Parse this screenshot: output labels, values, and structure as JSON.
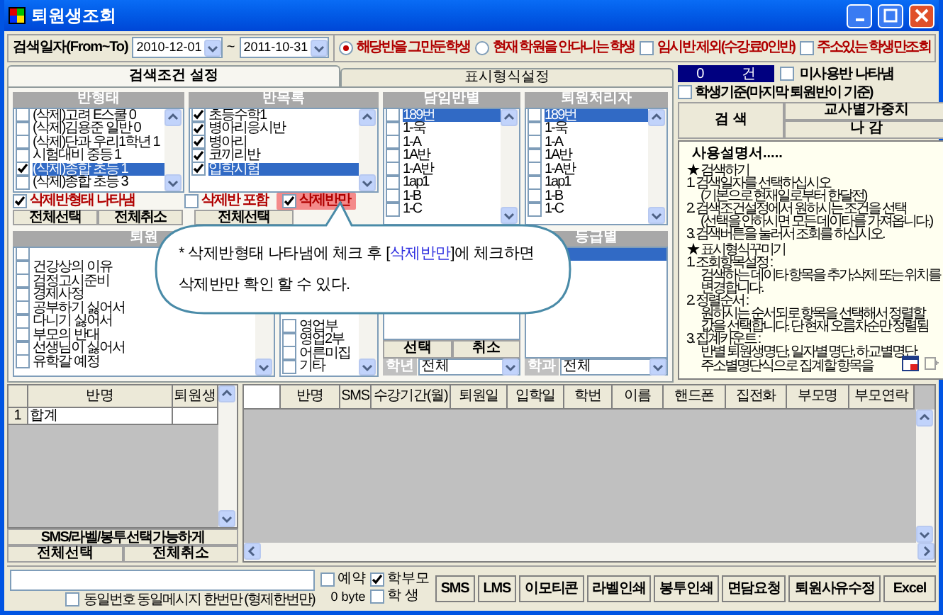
{
  "window": {
    "title": "퇴원생조회"
  },
  "search_bar": {
    "label": "검색일자(From~To)",
    "date_from": "2010-12-01",
    "separator": "~",
    "date_to": "2011-10-31",
    "options": [
      {
        "kind": "radio",
        "label": "해당반을 그만둔학생",
        "selected": true
      },
      {
        "kind": "radio",
        "label": "현재 학원을 안다니는 학생",
        "selected": false
      },
      {
        "kind": "checkbox",
        "label": "임시반 제외(수강료0인반)",
        "checked": false
      },
      {
        "kind": "checkbox",
        "label": "주소있는 학생만조회",
        "checked": false
      }
    ]
  },
  "tabs": [
    {
      "label": "검색조건 설정",
      "selected": true
    },
    {
      "label": "표시형식설정",
      "selected": false
    }
  ],
  "lists": [
    {
      "title": "반형태",
      "items": [
        {
          "label": "(삭제)고려 E스쿨 0",
          "checked": false,
          "selected": false
        },
        {
          "label": "(삭제)김용준 일반 0",
          "checked": false,
          "selected": false
        },
        {
          "label": "(삭제)단과 우리1학년 1",
          "checked": false,
          "selected": false
        },
        {
          "label": "시험대비 중등 1",
          "checked": false,
          "selected": false
        },
        {
          "label": "(삭제)종합 초등 1",
          "checked": true,
          "selected": true
        },
        {
          "label": "(삭제)종합 초등 3",
          "checked": false,
          "selected": false
        }
      ]
    },
    {
      "title": "반목록",
      "items": [
        {
          "label": "초등수학1",
          "checked": true,
          "selected": false
        },
        {
          "label": "병아리응시반",
          "checked": true,
          "selected": false
        },
        {
          "label": "병아리",
          "checked": true,
          "selected": false
        },
        {
          "label": "코끼리반",
          "checked": true,
          "selected": false
        },
        {
          "label": "입학시험",
          "checked": true,
          "selected": true
        }
      ]
    },
    {
      "title": "담임반별",
      "items": [
        {
          "label": "189번",
          "checked": false,
          "selected": true
        },
        {
          "label": "1-욱",
          "checked": false,
          "selected": false
        },
        {
          "label": "1-A",
          "checked": false,
          "selected": false
        },
        {
          "label": "1A반",
          "checked": false,
          "selected": false
        },
        {
          "label": "1-A반",
          "checked": false,
          "selected": false
        },
        {
          "label": "1ap1",
          "checked": false,
          "selected": false
        },
        {
          "label": "1-B",
          "checked": false,
          "selected": false
        },
        {
          "label": "1-C",
          "checked": false,
          "selected": false
        }
      ]
    },
    {
      "title": "퇴원처리자",
      "items": [
        {
          "label": "189번",
          "checked": false,
          "selected": true
        },
        {
          "label": "1-욱",
          "checked": false,
          "selected": false
        },
        {
          "label": "1-A",
          "checked": false,
          "selected": false
        },
        {
          "label": "1A반",
          "checked": false,
          "selected": false
        },
        {
          "label": "1-A반",
          "checked": false,
          "selected": false
        },
        {
          "label": "1ap1",
          "checked": false,
          "selected": false
        },
        {
          "label": "1-B",
          "checked": false,
          "selected": false
        },
        {
          "label": "1-C",
          "checked": false,
          "selected": false
        }
      ]
    }
  ],
  "list_options": [
    {
      "label": "삭제반형태 나타냄",
      "checked": true,
      "highlighted": false
    },
    {
      "label": "삭제반 포함",
      "checked": false,
      "highlighted": false
    },
    {
      "label": "삭제반만",
      "checked": true,
      "highlighted": true
    }
  ],
  "list_buttons": [
    "전체선택",
    "전체취소",
    "전체선택"
  ],
  "lower_lists": [
    {
      "title": "퇴원",
      "items": [
        {
          "checked": false
        },
        {
          "label": "건강상의 이유",
          "checked": false
        },
        {
          "label": "검정고시준비",
          "checked": false
        },
        {
          "label": "경제사정",
          "checked": false
        },
        {
          "label": "공부하기 싫어서",
          "checked": false
        },
        {
          "label": "다니기 싫어서",
          "checked": false
        },
        {
          "label": "부모의 반대",
          "checked": false
        },
        {
          "label": "선생님이 싫어서",
          "checked": false
        },
        {
          "label": "유학갈 예정",
          "checked": false
        }
      ]
    },
    {
      "items": [
        {
          "label": "영업부",
          "checked": false
        },
        {
          "label": "영업2부",
          "checked": false
        },
        {
          "label": "어른미집",
          "checked": false
        },
        {
          "label": "기타",
          "checked": false
        }
      ]
    }
  ],
  "teacher_buttons": [
    "선택",
    "취소"
  ],
  "grade_list": {
    "title": "등급별",
    "items": [
      {
        "selected": true
      }
    ]
  },
  "filters": [
    {
      "label": "학년",
      "value": "전체"
    },
    {
      "label": "학과",
      "value": "전체"
    }
  ],
  "callout": {
    "lines": [
      [
        {
          "text": "* 삭제반형태 나타냄에 체크 후 [",
          "highlight": false
        },
        {
          "text": "삭제반만",
          "highlight": true
        },
        {
          "text": "]에 체크하면",
          "highlight": false
        }
      ],
      [
        {
          "text": "삭제반만 확인 할 수 있다.",
          "highlight": false
        }
      ]
    ]
  },
  "right_panel": {
    "count": "0",
    "count_unit": "건",
    "unused_classes": {
      "label": "미사용반 나타냄",
      "checked": false
    },
    "student_basis": {
      "label": "학생기준(마지막 퇴원반이 기준)",
      "checked": false
    },
    "buttons": [
      "검 색",
      "교사별가중치",
      "나 감"
    ],
    "help": {
      "title": "사용설명서.....",
      "lines": [
        {
          "kind": "heading",
          "text": "★ 검색하기"
        },
        {
          "kind": "item",
          "text": "1. 검색일자를 선택하십시오"
        },
        {
          "kind": "note",
          "text": "(기본으로 현재일로부터 한달전)"
        },
        {
          "kind": "item",
          "text": "2. 검색조건설정에서 원하시는 조건을 선택"
        },
        {
          "kind": "note",
          "text": "(선택을 안하시면 모든 데이타를 가져옵니다.)"
        },
        {
          "kind": "item",
          "text": "3. 검색버튼을 눌러서 조회를 하십시오."
        },
        {
          "kind": "heading",
          "text": "★ 표시형식꾸미기"
        },
        {
          "kind": "item",
          "text": "1. 조회항목설정 :"
        },
        {
          "kind": "note",
          "text": "검색하는 데이타 항목을 추가,삭제 또는 위치를"
        },
        {
          "kind": "note",
          "text": "변경합니다."
        },
        {
          "kind": "item",
          "text": "2. 정렬순서 :"
        },
        {
          "kind": "note",
          "text": "원하시는 순서되로 항목을 선택해서 정렬할"
        },
        {
          "kind": "note",
          "text": "값을 선택합니다. 단 현재 오름차순만 정렬됨"
        },
        {
          "kind": "item",
          "text": "3. 집계카운트 :"
        },
        {
          "kind": "note",
          "text": "반별 퇴원생명단, 일자별 명단, 하교별명단"
        },
        {
          "kind": "note",
          "text": "주소별명단식으로 집계할 항목을"
        }
      ]
    }
  },
  "summary_grid": {
    "columns": [
      "반명",
      "퇴원생"
    ],
    "rows": [
      {
        "number": "1",
        "cells": [
          "합계"
        ]
      }
    ]
  },
  "summary_title": "SMS/라벨/봉투선택가능하게",
  "summary_buttons": [
    "전체선택",
    "전체취소"
  ],
  "result_grid": {
    "columns": [
      "반명",
      "SMS",
      "수강기간(월)",
      "퇴원일",
      "입학일",
      "학번",
      "이름",
      "핸드폰",
      "집전화",
      "부모명",
      "부모연락"
    ]
  },
  "message_bar": {
    "same_number": {
      "label": "동일번호 동일메시지 한번만 (형제한번만)",
      "checked": false
    },
    "targets": [
      {
        "label": "예약",
        "checked": false
      },
      {
        "label": "학부모",
        "checked": true
      },
      {
        "label": "학 생",
        "checked": false
      }
    ],
    "byte_count": "0 byte",
    "buttons": [
      "SMS",
      "LMS",
      "이모티콘",
      "라벨인쇄",
      "봉투인쇄",
      "면담요청",
      "퇴원사유수정",
      "Excel"
    ]
  }
}
